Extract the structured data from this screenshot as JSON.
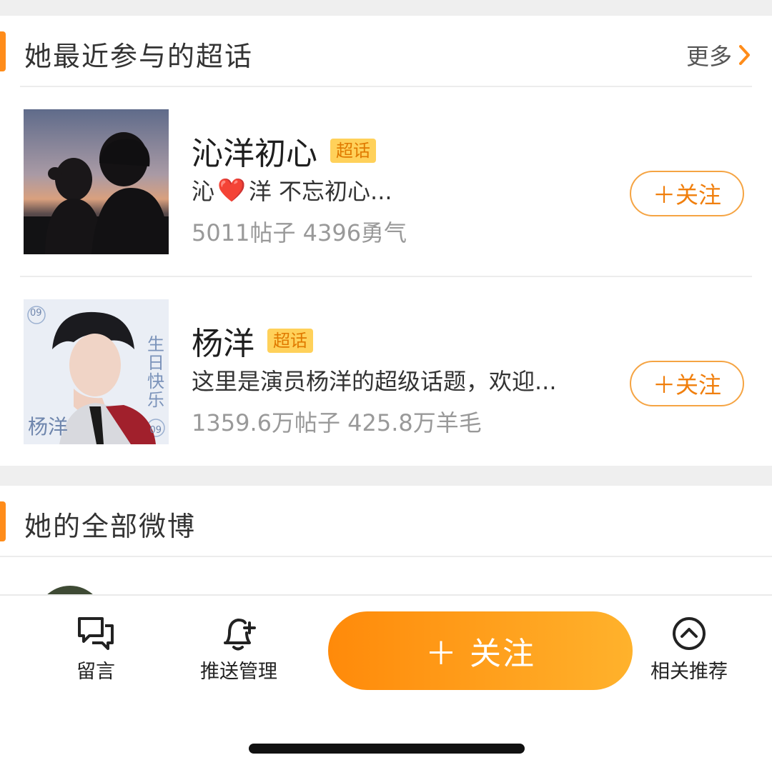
{
  "topics_section": {
    "title": "她最近参与的超话",
    "more_label": "更多",
    "accent_color": "#ff8c1a",
    "items": [
      {
        "name": "沁洋初心",
        "tag": "超话",
        "desc_prefix": "沁",
        "desc_emoji": "❤️",
        "desc_suffix": "洋 不忘初心...",
        "stats": "5011帖子 4396勇气",
        "follow_label": "＋关注",
        "thumb_icon": "silhouette-couple-image"
      },
      {
        "name": "杨洋",
        "tag": "超话",
        "desc": "这里是演员杨洋的超级话题，欢迎...",
        "stats": "1359.6万帖子 425.8万羊毛",
        "follow_label": "＋关注",
        "thumb_icon": "actor-birthday-poster-image",
        "poster_text": {
          "top": "09",
          "bottom": "09",
          "side": "生日快乐",
          "name": "杨洋"
        }
      }
    ]
  },
  "weibo_section": {
    "title": "她的全部微博"
  },
  "bottom_bar": {
    "tabs": [
      {
        "label": "留言",
        "icon": "chat-bubbles-icon"
      },
      {
        "label": "推送管理",
        "icon": "bell-plus-icon"
      },
      {
        "label": "相关推荐",
        "icon": "chevron-up-circle-icon"
      }
    ],
    "follow_label": "＋ 关注"
  }
}
